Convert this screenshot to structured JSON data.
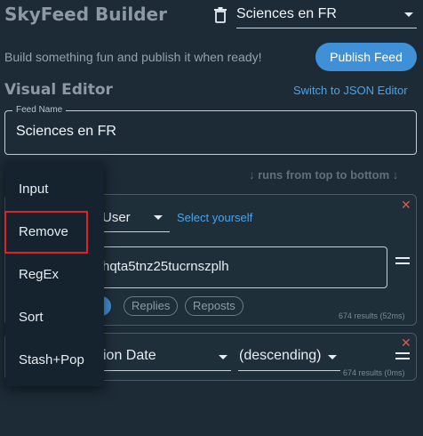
{
  "header": {
    "app_title": "SkyFeed Builder",
    "feed_select_value": "Sciences en FR",
    "tagline": "Build something fun and publish it when ready!",
    "publish_label": "Publish Feed"
  },
  "editor": {
    "section_title": "Visual Editor",
    "switch_link": "Switch to JSON Editor",
    "feed_name_label": "Feed Name",
    "feed_name_value": "Sciences en FR",
    "runs_note": "↓ runs from top to bottom ↓"
  },
  "block1": {
    "close": "✕",
    "user_select": "User",
    "select_yourself": "Select yourself",
    "did_value": "hqta5tnz25tucrnszplh",
    "chips": [
      "s",
      "Replies",
      "Reposts"
    ],
    "results": "674 results (52ms)"
  },
  "block2": {
    "close": "✕",
    "sort_select": "ion Date",
    "direction_select": "(descending)",
    "results": "674 results (0ms)"
  },
  "menu": {
    "items": [
      "Input",
      "Remove",
      "RegEx",
      "Sort",
      "Stash+Pop"
    ],
    "highlighted": "Remove"
  },
  "colors": {
    "background": "#1c2b36",
    "accent": "#3f90d6",
    "link": "#4aa3e8",
    "close": "#e25555",
    "highlight_border": "#e0212b"
  }
}
